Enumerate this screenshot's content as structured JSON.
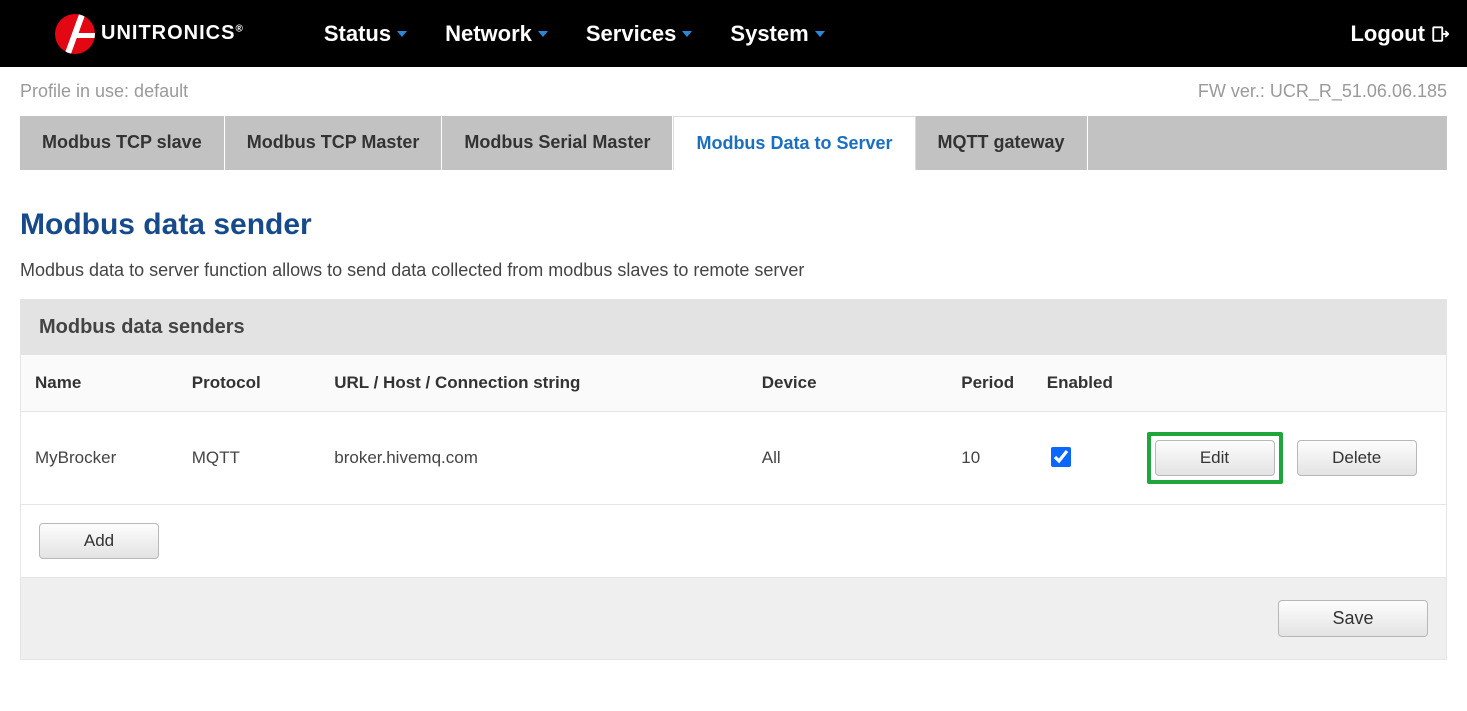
{
  "brand": {
    "name": "UNITRONICS",
    "reg": "®"
  },
  "menu": {
    "status": "Status",
    "network": "Network",
    "services": "Services",
    "system": "System"
  },
  "logout": "Logout",
  "profile_line": "Profile in use: default",
  "fw_line": "FW ver.: UCR_R_51.06.06.185",
  "tabs": {
    "tcp_slave": "Modbus TCP slave",
    "tcp_master": "Modbus TCP Master",
    "ser_master": "Modbus Serial Master",
    "data_server": "Modbus Data to Server",
    "mqtt_gw": "MQTT gateway"
  },
  "page": {
    "title": "Modbus data sender",
    "desc": "Modbus data to server function allows to send data collected from modbus slaves to remote server",
    "panel_title": "Modbus data senders"
  },
  "table": {
    "headers": {
      "name": "Name",
      "protocol": "Protocol",
      "url": "URL / Host / Connection string",
      "device": "Device",
      "period": "Period",
      "enabled": "Enabled"
    },
    "rows": [
      {
        "name": "MyBrocker",
        "protocol": "MQTT",
        "url": "broker.hivemq.com",
        "device": "All",
        "period": "10",
        "enabled": true
      }
    ]
  },
  "buttons": {
    "edit": "Edit",
    "delete": "Delete",
    "add": "Add",
    "save": "Save"
  }
}
